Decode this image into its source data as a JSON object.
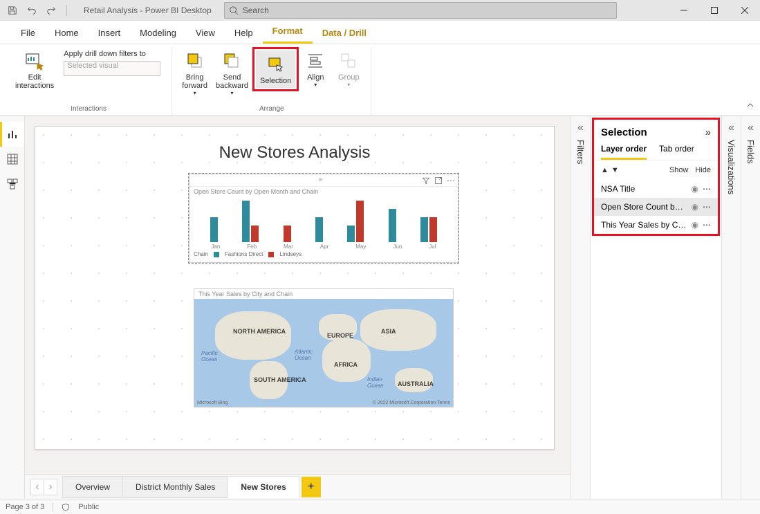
{
  "app_title": "Retail Analysis - Power BI Desktop",
  "search_placeholder": "Search",
  "ribbon_tabs": [
    "File",
    "Home",
    "Insert",
    "Modeling",
    "View",
    "Help",
    "Format",
    "Data / Drill"
  ],
  "active_tab": "Format",
  "ribbon": {
    "edit_interactions": "Edit\ninteractions",
    "drill_label": "Apply drill down filters to",
    "drill_value": "Selected visual",
    "interactions_group": "Interactions",
    "bring_forward": "Bring\nforward",
    "send_backward": "Send\nbackward",
    "selection": "Selection",
    "align": "Align",
    "group": "Group",
    "arrange_group": "Arrange"
  },
  "report": {
    "title": "New Stores Analysis",
    "chart_visual_title": "Open Store Count by Open Month and Chain",
    "map_visual_title": "This Year Sales by City and Chain",
    "legend_label": "Chain",
    "legend_a": "Fashions Direct",
    "legend_b": "Lindseys",
    "map": {
      "na": "NORTH AMERICA",
      "eu": "EUROPE",
      "as": "ASIA",
      "af": "AFRICA",
      "sa": "SOUTH AMERICA",
      "au": "AUSTRALIA",
      "pacific": "Pacific\nOcean",
      "atlantic": "Atlantic\nOcean",
      "indian": "Indian\nOcean",
      "credit": "© 2022 Microsoft Corporation   Terms",
      "logo": "Microsoft Bing"
    }
  },
  "chart_data": {
    "type": "bar",
    "title": "Open Store Count by Open Month and Chain",
    "categories": [
      "Jan",
      "Feb",
      "Mar",
      "Apr",
      "May",
      "Jun",
      "Jul"
    ],
    "series": [
      {
        "name": "Fashions Direct",
        "values": [
          3,
          5,
          0,
          3,
          2,
          4,
          3
        ]
      },
      {
        "name": "Lindseys",
        "values": [
          0,
          2,
          2,
          0,
          5,
          0,
          3
        ]
      }
    ],
    "ylim": [
      0,
      5
    ],
    "colors": {
      "Fashions Direct": "#2e8b9b",
      "Lindseys": "#c0392b"
    }
  },
  "panes": {
    "filters": "Filters",
    "visualizations": "Visualizations",
    "fields": "Fields",
    "selection_title": "Selection",
    "layer_order": "Layer order",
    "tab_order": "Tab order",
    "show": "Show",
    "hide": "Hide",
    "items": [
      "NSA Title",
      "Open Store Count by ...",
      "This Year Sales by City..."
    ]
  },
  "page_tabs": [
    "Overview",
    "District Monthly Sales",
    "New Stores"
  ],
  "status": {
    "page": "Page 3 of 3",
    "sens": "Public"
  },
  "add_page": "+"
}
